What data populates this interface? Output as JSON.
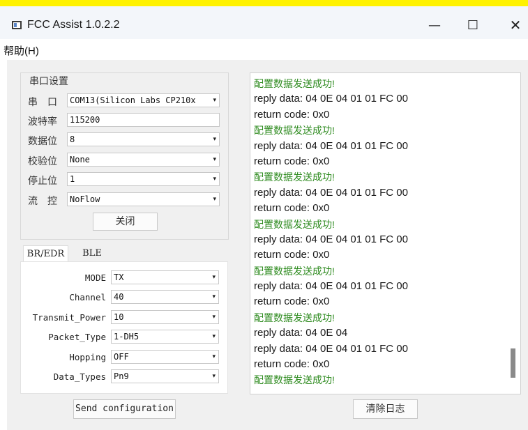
{
  "window": {
    "title": "FCC Assist 1.0.2.2",
    "minimize": "—",
    "maximize": "☐",
    "close": "✕"
  },
  "menu": {
    "help": "帮助(H)"
  },
  "serial": {
    "group_title": "串口设置",
    "fields": [
      {
        "label": "串　口",
        "value": "COM13(Silicon Labs CP210x",
        "dropdown": true
      },
      {
        "label": "波特率",
        "value": "115200",
        "dropdown": false
      },
      {
        "label": "数据位",
        "value": "8",
        "dropdown": true
      },
      {
        "label": "校验位",
        "value": "None",
        "dropdown": true
      },
      {
        "label": "停止位",
        "value": "1",
        "dropdown": true
      },
      {
        "label": "流　控",
        "value": "NoFlow",
        "dropdown": true
      }
    ],
    "close_button": "关闭"
  },
  "tabs": {
    "br_edr": "BR/EDR",
    "ble": "BLE"
  },
  "params": [
    {
      "label": "MODE",
      "value": "TX"
    },
    {
      "label": "Channel",
      "value": "40"
    },
    {
      "label": "Transmit_Power",
      "value": "10"
    },
    {
      "label": "Packet_Type",
      "value": "1-DH5"
    },
    {
      "label": "Hopping",
      "value": "OFF"
    },
    {
      "label": "Data_Types",
      "value": "Pn9"
    }
  ],
  "send_button": "Send configuration",
  "clear_button": "清除日志",
  "log": [
    {
      "kind": "success",
      "text": "配置数据发送成功!"
    },
    {
      "kind": "data",
      "text": "reply data: 04 0E 04 01 01 FC 00"
    },
    {
      "kind": "data",
      "text": "return code: 0x0"
    },
    {
      "kind": "success",
      "text": "配置数据发送成功!"
    },
    {
      "kind": "data",
      "text": "reply data: 04 0E 04 01 01 FC 00"
    },
    {
      "kind": "data",
      "text": "return code: 0x0"
    },
    {
      "kind": "success",
      "text": "配置数据发送成功!"
    },
    {
      "kind": "data",
      "text": "reply data: 04 0E 04 01 01 FC 00"
    },
    {
      "kind": "data",
      "text": "return code: 0x0"
    },
    {
      "kind": "success",
      "text": "配置数据发送成功!"
    },
    {
      "kind": "data",
      "text": "reply data: 04 0E 04 01 01 FC 00"
    },
    {
      "kind": "data",
      "text": "return code: 0x0"
    },
    {
      "kind": "success",
      "text": "配置数据发送成功!"
    },
    {
      "kind": "data",
      "text": "reply data: 04 0E 04 01 01 FC 00"
    },
    {
      "kind": "data",
      "text": "return code: 0x0"
    },
    {
      "kind": "success",
      "text": "配置数据发送成功!"
    },
    {
      "kind": "data",
      "text": "reply data: 04 0E 04"
    },
    {
      "kind": "data",
      "text": "reply data: 04 0E 04 01 01 FC 00"
    },
    {
      "kind": "data",
      "text": "return code: 0x0"
    },
    {
      "kind": "success",
      "text": "配置数据发送成功!"
    }
  ],
  "colors": {
    "success": "#2e8b1f",
    "top_strip": "#fff200"
  }
}
